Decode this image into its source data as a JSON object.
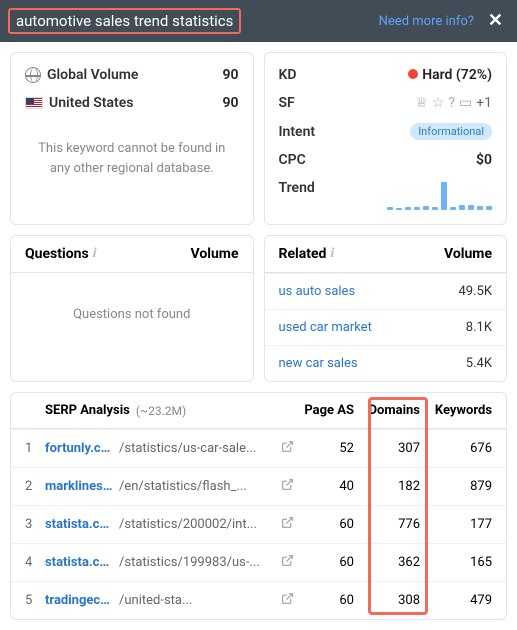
{
  "header": {
    "title": "automotive sales trend statistics",
    "info_link": "Need more info?",
    "close": "✕"
  },
  "overview": {
    "global_label": "Global Volume",
    "global_value": "90",
    "us_label": "United States",
    "us_value": "90",
    "no_regional_msg": "This keyword cannot be found in any other regional database."
  },
  "metrics": {
    "kd_label": "KD",
    "kd_value": "Hard (72%)",
    "sf_label": "SF",
    "sf_plus": "+1",
    "intent_label": "Intent",
    "intent_value": "Informational",
    "cpc_label": "CPC",
    "cpc_value": "$0",
    "trend_label": "Trend"
  },
  "chart_data": {
    "type": "bar",
    "values": [
      2,
      0,
      2,
      2,
      3,
      2,
      22,
      2,
      4,
      4,
      3,
      3
    ],
    "ylim": [
      0,
      22
    ]
  },
  "questions": {
    "title": "Questions",
    "volume_col": "Volume",
    "empty_msg": "Questions not found"
  },
  "related": {
    "title": "Related",
    "volume_col": "Volume",
    "items": [
      {
        "label": "us auto sales",
        "volume": "49.5K"
      },
      {
        "label": "used car market",
        "volume": "8.1K"
      },
      {
        "label": "new car sales",
        "volume": "5.4K"
      }
    ]
  },
  "serp": {
    "title": "SERP Analysis",
    "count": "(~23.2M)",
    "col_as": "Page AS",
    "col_domains": "Domains",
    "col_keywords": "Keywords",
    "rows": [
      {
        "rank": "1",
        "domain": "fortunly.com",
        "path": "/statistics/us-car-sale...",
        "as": "52",
        "domains": "307",
        "kw": "676"
      },
      {
        "rank": "2",
        "domain": "marklines.com",
        "path": "/en/statistics/flash_...",
        "as": "40",
        "domains": "182",
        "kw": "879"
      },
      {
        "rank": "3",
        "domain": "statista.com",
        "path": "/statistics/200002/int...",
        "as": "60",
        "domains": "776",
        "kw": "177"
      },
      {
        "rank": "4",
        "domain": "statista.com",
        "path": "/statistics/199983/us-...",
        "as": "60",
        "domains": "362",
        "kw": "165"
      },
      {
        "rank": "5",
        "domain": "tradingeconomics.com",
        "path": "/united-sta...",
        "as": "60",
        "domains": "308",
        "kw": "479"
      }
    ]
  }
}
